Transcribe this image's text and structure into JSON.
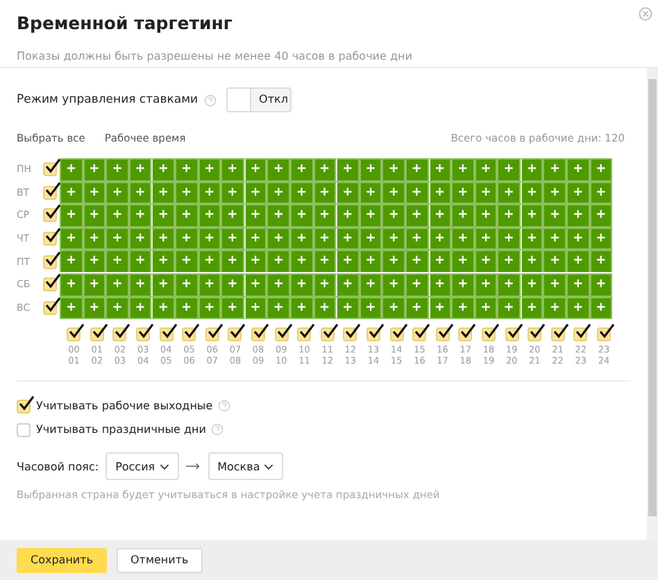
{
  "dialog": {
    "title": "Временной таргетинг",
    "subtitle": "Показы должны быть разрешены не менее 40 часов в рабочие дни"
  },
  "bid_mode": {
    "label": "Режим управления ставками",
    "on": false,
    "state_text": "Откл"
  },
  "links": [
    "Выбрать все",
    "Рабочее время"
  ],
  "total_hours": "Всего часов в рабочие дни: 120",
  "days": [
    {
      "label": "ПН",
      "checked": true,
      "cells": [
        true,
        true,
        true,
        true,
        true,
        true,
        true,
        true,
        true,
        true,
        true,
        true,
        true,
        true,
        true,
        true,
        true,
        true,
        true,
        true,
        true,
        true,
        true,
        true
      ]
    },
    {
      "label": "ВТ",
      "checked": true,
      "cells": [
        true,
        true,
        true,
        true,
        true,
        true,
        true,
        true,
        true,
        true,
        true,
        true,
        true,
        true,
        true,
        true,
        true,
        true,
        true,
        true,
        true,
        true,
        true,
        true
      ]
    },
    {
      "label": "СР",
      "checked": true,
      "cells": [
        true,
        true,
        true,
        true,
        true,
        true,
        true,
        true,
        true,
        true,
        true,
        true,
        true,
        true,
        true,
        true,
        true,
        true,
        true,
        true,
        true,
        true,
        true,
        true
      ]
    },
    {
      "label": "ЧТ",
      "checked": true,
      "cells": [
        true,
        true,
        true,
        true,
        true,
        true,
        true,
        true,
        true,
        true,
        true,
        true,
        true,
        true,
        true,
        true,
        true,
        true,
        true,
        true,
        true,
        true,
        true,
        true
      ]
    },
    {
      "label": "ПТ",
      "checked": true,
      "cells": [
        true,
        true,
        true,
        true,
        true,
        true,
        true,
        true,
        true,
        true,
        true,
        true,
        true,
        true,
        true,
        true,
        true,
        true,
        true,
        true,
        true,
        true,
        true,
        true
      ]
    },
    {
      "label": "СБ",
      "checked": true,
      "cells": [
        true,
        true,
        true,
        true,
        true,
        true,
        true,
        true,
        true,
        true,
        true,
        true,
        true,
        true,
        true,
        true,
        true,
        true,
        true,
        true,
        true,
        true,
        true,
        true
      ]
    },
    {
      "label": "ВС",
      "checked": true,
      "cells": [
        true,
        true,
        true,
        true,
        true,
        true,
        true,
        true,
        true,
        true,
        true,
        true,
        true,
        true,
        true,
        true,
        true,
        true,
        true,
        true,
        true,
        true,
        true,
        true
      ]
    }
  ],
  "cell_mark": "+",
  "hours": [
    {
      "from": "00",
      "to": "01",
      "checked": true
    },
    {
      "from": "01",
      "to": "02",
      "checked": true
    },
    {
      "from": "02",
      "to": "03",
      "checked": true
    },
    {
      "from": "03",
      "to": "04",
      "checked": true
    },
    {
      "from": "04",
      "to": "05",
      "checked": true
    },
    {
      "from": "05",
      "to": "06",
      "checked": true
    },
    {
      "from": "06",
      "to": "07",
      "checked": true
    },
    {
      "from": "07",
      "to": "08",
      "checked": true
    },
    {
      "from": "08",
      "to": "09",
      "checked": true
    },
    {
      "from": "09",
      "to": "10",
      "checked": true
    },
    {
      "from": "10",
      "to": "11",
      "checked": true
    },
    {
      "from": "11",
      "to": "12",
      "checked": true
    },
    {
      "from": "12",
      "to": "13",
      "checked": true
    },
    {
      "from": "13",
      "to": "14",
      "checked": true
    },
    {
      "from": "14",
      "to": "15",
      "checked": true
    },
    {
      "from": "15",
      "to": "16",
      "checked": true
    },
    {
      "from": "16",
      "to": "17",
      "checked": true
    },
    {
      "from": "17",
      "to": "18",
      "checked": true
    },
    {
      "from": "18",
      "to": "19",
      "checked": true
    },
    {
      "from": "19",
      "to": "20",
      "checked": true
    },
    {
      "from": "20",
      "to": "21",
      "checked": true
    },
    {
      "from": "21",
      "to": "22",
      "checked": true
    },
    {
      "from": "22",
      "to": "23",
      "checked": true
    },
    {
      "from": "23",
      "to": "24",
      "checked": true
    }
  ],
  "options": [
    {
      "label": "Учитывать рабочие выходные",
      "checked": true
    },
    {
      "label": "Учитывать праздничные дни",
      "checked": false
    }
  ],
  "timezone": {
    "label": "Часовой пояс:",
    "country": "Россия",
    "city": "Москва",
    "hint": "Выбранная страна будет учитываться в настройке учета праздничных дней"
  },
  "buttons": [
    {
      "label": "Сохранить",
      "kind": "primary"
    },
    {
      "label": "Отменить",
      "kind": "secondary"
    }
  ]
}
